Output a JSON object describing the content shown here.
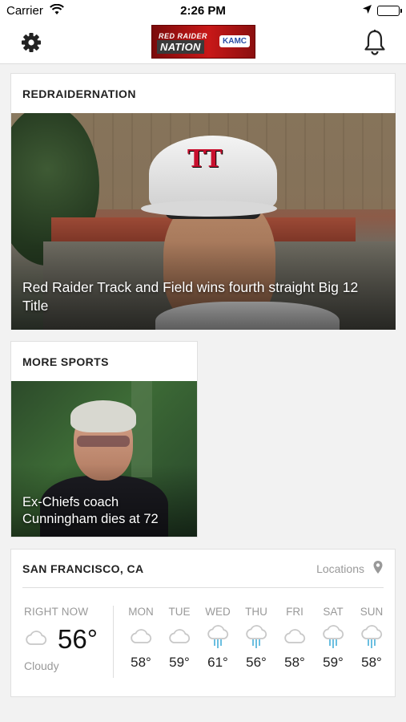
{
  "status_bar": {
    "carrier": "Carrier",
    "time": "2:26 PM"
  },
  "nav": {
    "settings_icon": "gear-icon",
    "notifications_icon": "bell-icon",
    "logo": {
      "top_text": "RED RAIDER",
      "name": "NATION",
      "station": "KAMC"
    }
  },
  "top_story": {
    "section": "REDRAIDERNATION",
    "headline": "Red Raider Track and Field wins fourth straight Big 12 Title"
  },
  "more_sports": {
    "section": "MORE SPORTS",
    "headline": "Ex-Chiefs coach Cunningham dies at 72"
  },
  "weather": {
    "city": "SAN FRANCISCO, CA",
    "locations_label": "Locations",
    "now": {
      "label": "RIGHT NOW",
      "temp": "56°",
      "condition": "Cloudy",
      "icon": "cloud-icon"
    },
    "forecast": [
      {
        "day": "MON",
        "temp": "58°",
        "icon": "cloud"
      },
      {
        "day": "TUE",
        "temp": "59°",
        "icon": "cloud"
      },
      {
        "day": "WED",
        "temp": "61°",
        "icon": "rain"
      },
      {
        "day": "THU",
        "temp": "56°",
        "icon": "rain"
      },
      {
        "day": "FRI",
        "temp": "58°",
        "icon": "cloud"
      },
      {
        "day": "SAT",
        "temp": "59°",
        "icon": "rain"
      },
      {
        "day": "SUN",
        "temp": "58°",
        "icon": "rain"
      }
    ],
    "colors": {
      "cloud": "#c8c8c8",
      "rain": "#6bbfe0"
    }
  }
}
